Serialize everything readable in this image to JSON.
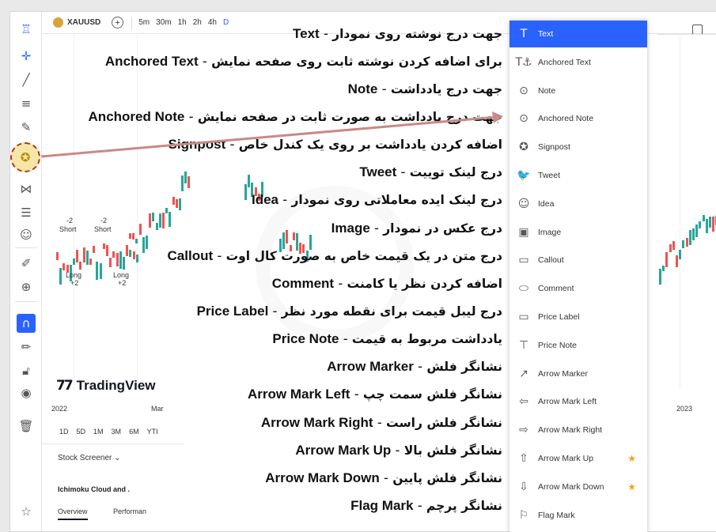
{
  "toolbar": {
    "symbol": "XAUUSD",
    "add": "+",
    "timeframes": [
      "5m",
      "30m",
      "1h",
      "2h",
      "4h",
      "D"
    ],
    "active_timeframe": "D"
  },
  "left_tools": [
    "tt-logo",
    "crosshair",
    "trend-line",
    "fib",
    "brush",
    "signpost",
    "pattern",
    "projection",
    "emoji",
    "ruler",
    "zoom",
    "magnet",
    "lock-draw",
    "lock",
    "eye",
    "trash",
    "star"
  ],
  "chart": {
    "logo": "TradingView",
    "date_left": "2022",
    "date_mar": "Mar",
    "date_right": "2023",
    "labels": [
      "Short",
      "Short",
      "Long",
      "Long",
      "-2",
      "-2",
      "+2",
      "+2"
    ],
    "ranges": [
      "1D",
      "5D",
      "1M",
      "3M",
      "6M",
      "YTI"
    ],
    "screener": "Stock Screener",
    "indicator": "Ichimoku Cloud and .",
    "tabs": [
      "Overview",
      "Performan"
    ]
  },
  "annotations": [
    {
      "en": "Text",
      "fa": "جهت درج نوشته روی نمودار"
    },
    {
      "en": "Anchored Text",
      "fa": "برای اضافه کردن نوشته ثابت روی صفحه نمایش"
    },
    {
      "en": "Note",
      "fa": "جهت درج یادداشت"
    },
    {
      "en": "Anchored Note",
      "fa": "جهت درج یادداشت به صورت ثابت در صفحه نمایش"
    },
    {
      "en": "Signpost",
      "fa": "اضافه کردن یادداشت بر روی یک کندل خاص"
    },
    {
      "en": "Tweet",
      "fa": "درج لینک توییت"
    },
    {
      "en": "Idea",
      "fa": "درج لینک ایده معاملاتی روی نمودار"
    },
    {
      "en": "Image",
      "fa": "درج عکس در نمودار"
    },
    {
      "en": "Callout",
      "fa": "درج متن در یک قیمت خاص به صورت کال اوت"
    },
    {
      "en": "Comment",
      "fa": "اضافه کردن نظر یا کامنت"
    },
    {
      "en": "Price Label",
      "fa": "درج لیبل قیمت برای نقطه مورد نظر"
    },
    {
      "en": "Price Note",
      "fa": "یادداشت مربوط به قیمت"
    },
    {
      "en": "Arrow Marker",
      "fa": "نشانگر فلش"
    },
    {
      "en": "Arrow Mark Left",
      "fa": "نشانگر فلش سمت چپ"
    },
    {
      "en": "Arrow Mark Right",
      "fa": "نشانگر فلش راست"
    },
    {
      "en": "Arrow Mark Up",
      "fa": "نشانگر فلش بالا"
    },
    {
      "en": "Arrow Mark Down",
      "fa": "نشانگر فلش پایین"
    },
    {
      "en": "Flag Mark",
      "fa": "نشانگر پرچم"
    }
  ],
  "menu": [
    {
      "label": "Text",
      "icon": "T",
      "selected": true,
      "star": false
    },
    {
      "label": "Anchored Text",
      "icon": "T⚓",
      "selected": false,
      "star": false
    },
    {
      "label": "Note",
      "icon": "⊙",
      "selected": false,
      "star": false
    },
    {
      "label": "Anchored Note",
      "icon": "⊙",
      "selected": false,
      "star": false
    },
    {
      "label": "Signpost",
      "icon": "✪",
      "selected": false,
      "star": false
    },
    {
      "label": "Tweet",
      "icon": "🐦",
      "selected": false,
      "star": false
    },
    {
      "label": "Idea",
      "icon": "☺",
      "selected": false,
      "star": false
    },
    {
      "label": "Image",
      "icon": "▣",
      "selected": false,
      "star": false
    },
    {
      "label": "Callout",
      "icon": "▭",
      "selected": false,
      "star": false
    },
    {
      "label": "Comment",
      "icon": "⬭",
      "selected": false,
      "star": false
    },
    {
      "label": "Price Label",
      "icon": "▭",
      "selected": false,
      "star": false
    },
    {
      "label": "Price Note",
      "icon": "⊤",
      "selected": false,
      "star": false
    },
    {
      "label": "Arrow Marker",
      "icon": "↗",
      "selected": false,
      "star": false
    },
    {
      "label": "Arrow Mark Left",
      "icon": "⇦",
      "selected": false,
      "star": false
    },
    {
      "label": "Arrow Mark Right",
      "icon": "⇨",
      "selected": false,
      "star": false
    },
    {
      "label": "Arrow Mark Up",
      "icon": "⇧",
      "selected": false,
      "star": true
    },
    {
      "label": "Arrow Mark Down",
      "icon": "⇩",
      "selected": false,
      "star": true
    },
    {
      "label": "Flag Mark",
      "icon": "⚐",
      "selected": false,
      "star": false
    }
  ],
  "colors": {
    "accent": "#2962ff",
    "arrow": "#b5331e",
    "star": "#f2a417",
    "up": "#26a69a",
    "down": "#ef5350"
  }
}
